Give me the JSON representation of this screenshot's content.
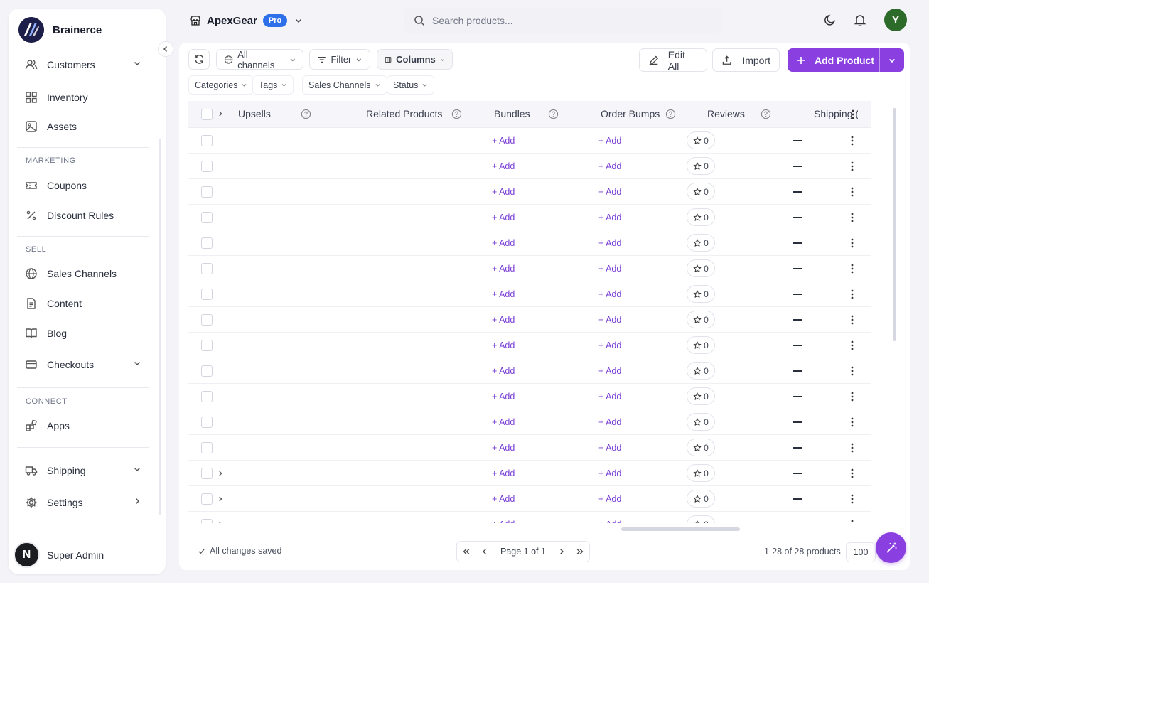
{
  "brand": {
    "name": "Brainerce"
  },
  "sidebar": {
    "items": [
      {
        "label": "Customers",
        "icon": "users-icon"
      },
      {
        "label": "Inventory",
        "icon": "grid-icon"
      },
      {
        "label": "Assets",
        "icon": "image-icon"
      },
      {
        "label": "Coupons",
        "icon": "ticket-icon"
      },
      {
        "label": "Discount Rules",
        "icon": "percent-icon"
      },
      {
        "label": "Sales Channels",
        "icon": "globe-icon"
      },
      {
        "label": "Content",
        "icon": "file-icon"
      },
      {
        "label": "Blog",
        "icon": "book-icon"
      },
      {
        "label": "Checkouts",
        "icon": "card-icon"
      },
      {
        "label": "Apps",
        "icon": "apps-icon"
      },
      {
        "label": "Shipping",
        "icon": "truck-icon"
      },
      {
        "label": "Settings",
        "icon": "gear-icon"
      }
    ],
    "sections": {
      "marketing": "MARKETING",
      "sell": "SELL",
      "connect": "CONNECT"
    },
    "user": {
      "initial": "N",
      "name": "Super Admin"
    }
  },
  "header": {
    "store_name": "ApexGear",
    "plan_badge": "Pro",
    "search_placeholder": "Search products...",
    "avatar_initial": "Y"
  },
  "toolbar": {
    "channels_label": "All channels",
    "filter_label": "Filter",
    "columns_label": "Columns",
    "edit_all_label": "Edit All",
    "import_label": "Import",
    "add_product_label": "Add Product",
    "filters": [
      "Categories",
      "Tags",
      "Sales Channels",
      "Status"
    ]
  },
  "table": {
    "columns": [
      "Upsells",
      "Related Products",
      "Bundles",
      "Order Bumps",
      "Reviews",
      "Shipping ("
    ],
    "add_label": "+ Add",
    "review_count": "0",
    "rows_visible": 16
  },
  "footer": {
    "saved_status": "All changes saved",
    "page_label": "Page 1 of 1",
    "range_label": "1-28 of 28 products",
    "per_page": "100"
  },
  "colors": {
    "accent": "#8a3fe0",
    "badge": "#2d6fe9",
    "avatar": "#2d6b2a"
  }
}
